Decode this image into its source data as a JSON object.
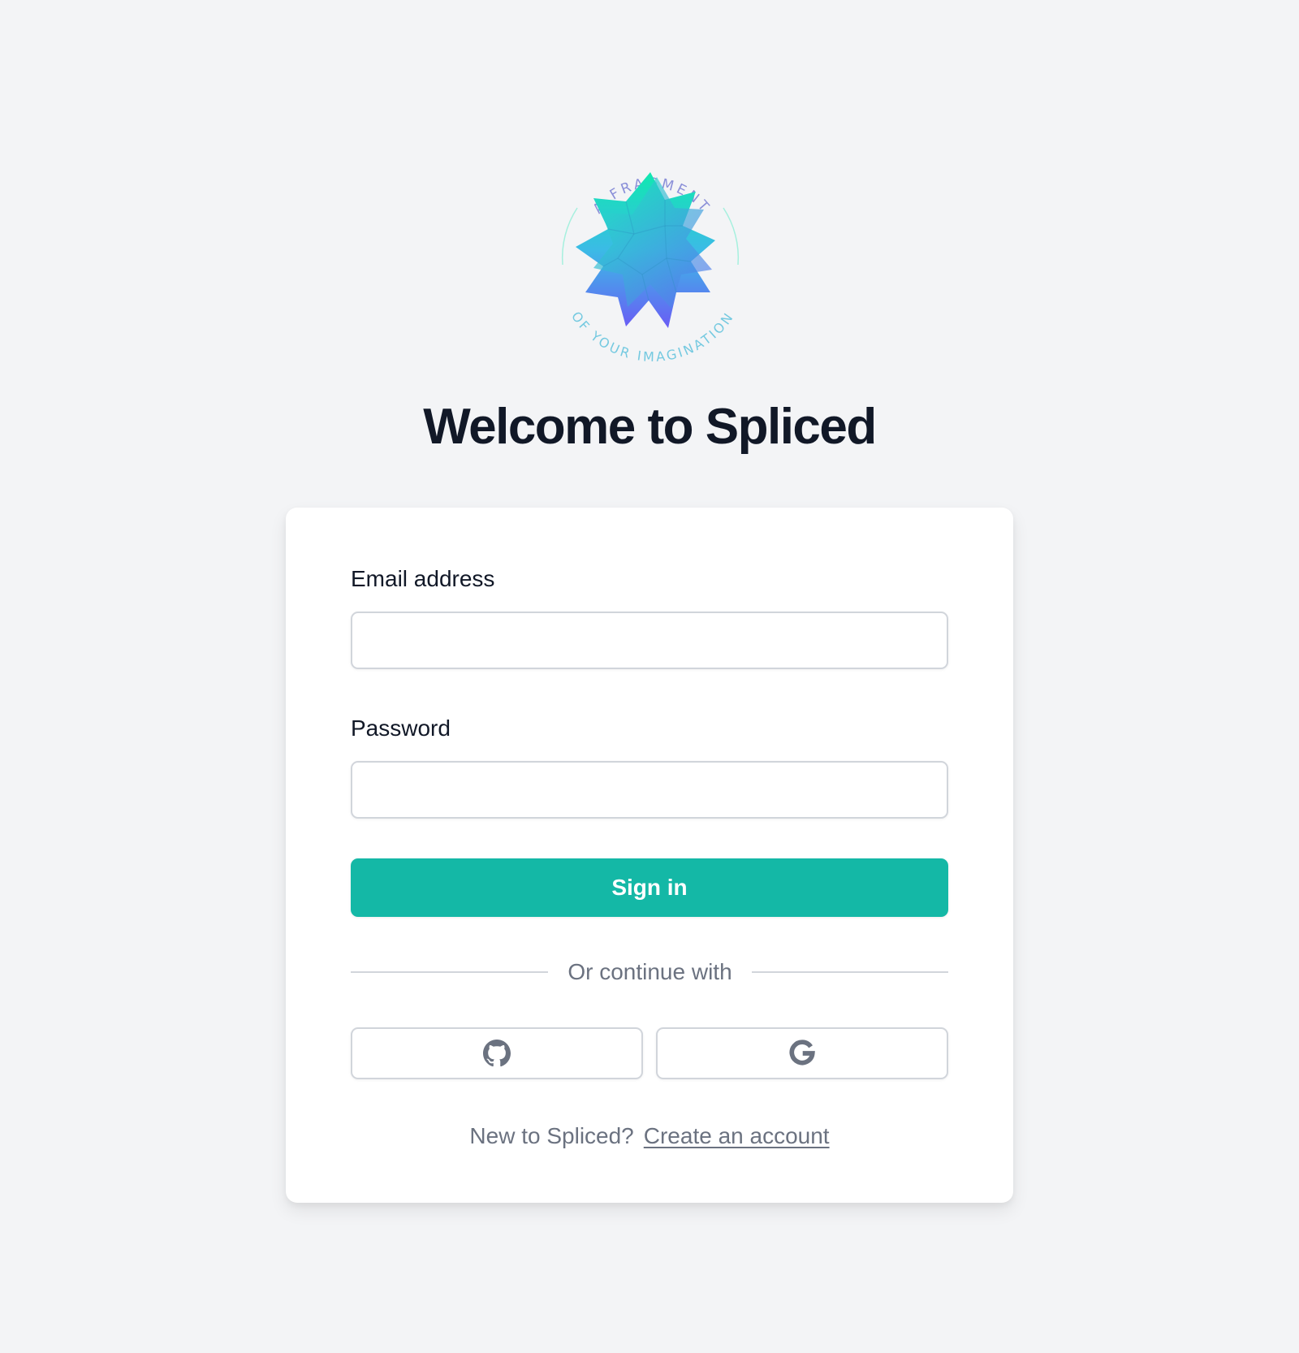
{
  "logo": {
    "top_arc_text": "A FRAGMENT",
    "bottom_arc_text": "OF YOUR IMAGINATION"
  },
  "page_title": "Welcome to Spliced",
  "form": {
    "email_label": "Email address",
    "email_value": "",
    "password_label": "Password",
    "password_value": "",
    "signin_label": "Sign in"
  },
  "divider_text": "Or continue with",
  "social": [
    {
      "icon": "github-icon"
    },
    {
      "icon": "google-icon"
    }
  ],
  "footer": {
    "prompt": "New to Spliced?",
    "link": "Create an account"
  },
  "colors": {
    "background": "#f3f4f6",
    "accent": "#14b8a6",
    "heading": "#111827",
    "muted": "#6b7280"
  }
}
